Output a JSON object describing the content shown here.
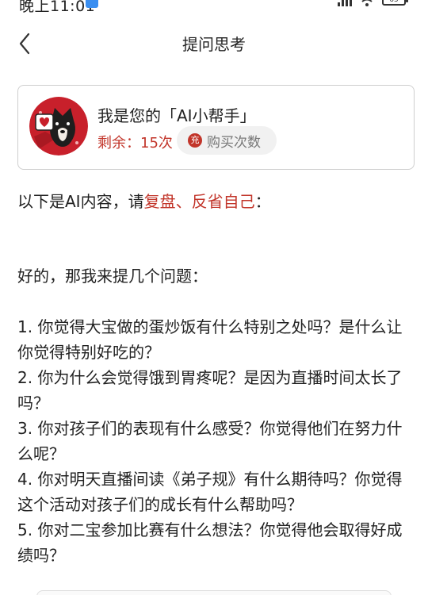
{
  "status_bar": {
    "time": "晚上11:01",
    "battery": "65"
  },
  "header": {
    "back_icon": "chevron-left-icon",
    "title": "提问思考"
  },
  "assistant_card": {
    "title": "我是您的「AI小帮手」",
    "remaining": "剩余：15次",
    "buy_icon_text": "充",
    "buy_label": "购买次数"
  },
  "intro": {
    "prefix": "以下是AI内容，请",
    "highlight": "复盘、反省自己",
    "suffix": "："
  },
  "content": {
    "greeting": "好的，那我来提几个问题：",
    "questions": [
      "1. 你觉得大宝做的蛋炒饭有什么特别之处吗？是什么让你觉得特别好吃的？",
      "2. 你为什么会觉得饿到胃疼呢？是因为直播时间太长了吗？",
      "3. 你对孩子们的表现有什么感受？你觉得他们在努力什么呢？",
      "4. 你对明天直播间读《弟子规》有什么期待吗？你觉得这个活动对孩子们的成长有什么帮助吗？",
      "5. 你对二宝参加比赛有什么想法？你觉得他会取得好成绩吗？"
    ]
  },
  "colors": {
    "accent": "#c2352a",
    "card_border": "#cfcfcf",
    "button_bg": "#f1f1f1"
  }
}
